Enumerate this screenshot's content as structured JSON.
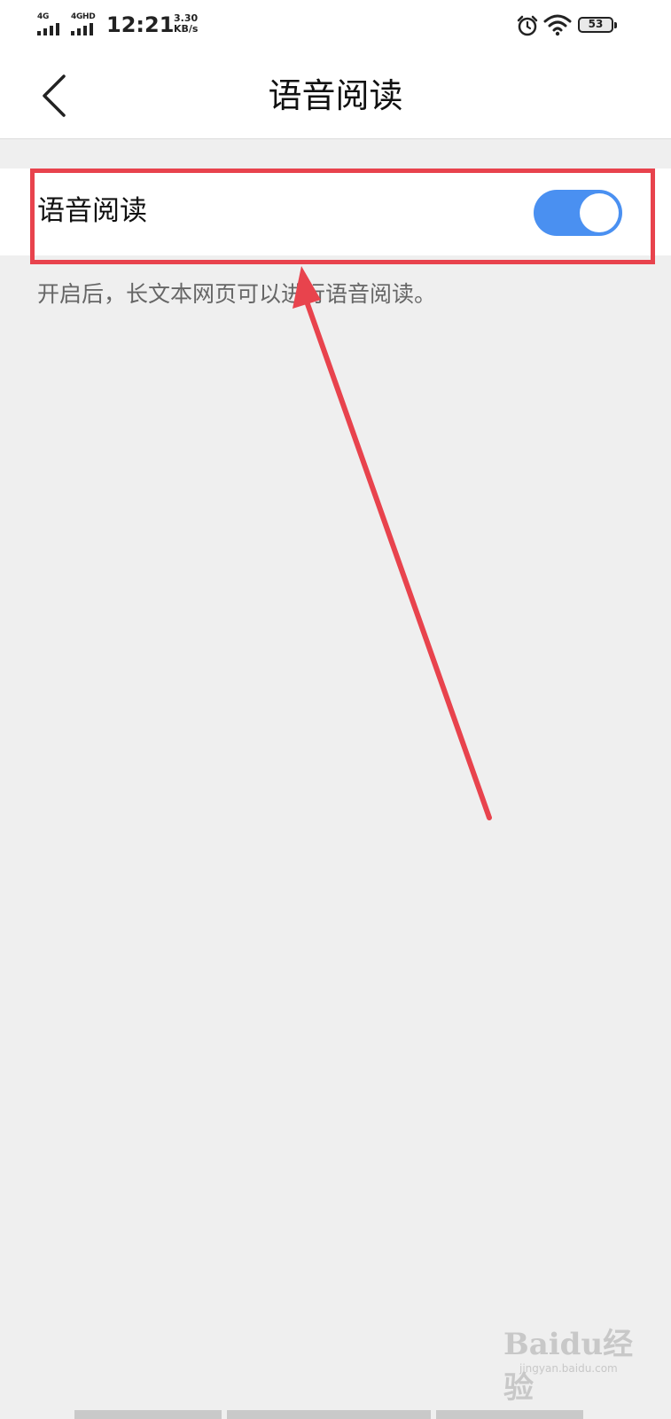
{
  "status_bar": {
    "network_1": "4G",
    "network_2": "4GHD",
    "time": "12:21",
    "speed_value": "3.30",
    "speed_unit": "KB/s",
    "battery": "53",
    "icons": [
      "signal-icon",
      "alarm-icon",
      "wifi-icon",
      "battery-icon"
    ]
  },
  "header": {
    "title": "语音阅读",
    "back_icon": "chevron-left-icon"
  },
  "setting": {
    "label": "语音阅读",
    "toggle_on": true,
    "hint": "开启后，长文本网页可以进行语音阅读。"
  },
  "watermark": {
    "logo": "Baidu经验",
    "url": "jingyan.baidu.com"
  },
  "colors": {
    "toggle_on": "#4a90f1",
    "annotation": "#e8434d",
    "background": "#efefef"
  }
}
